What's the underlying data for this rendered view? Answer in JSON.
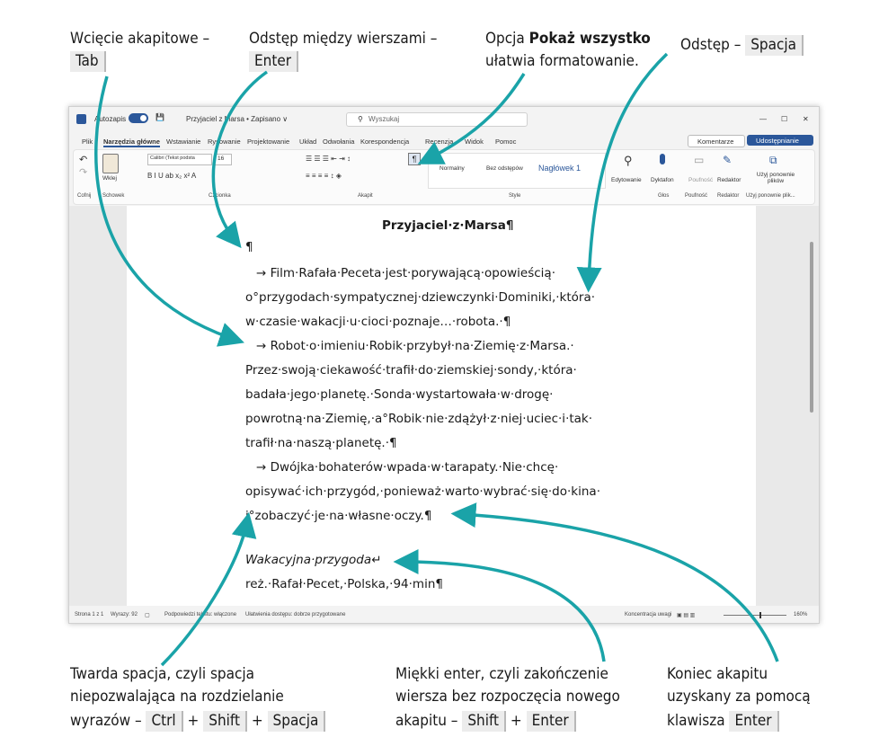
{
  "annotations": {
    "tab": {
      "text": "Wcięcie akapitowe –",
      "key": "Tab"
    },
    "enter": {
      "text": "Odstęp między wierszami –",
      "key": "Enter"
    },
    "show_all": {
      "pre": "Opcja ",
      "bold": "Pokaż wszystko",
      "post": "ułatwia formatowanie."
    },
    "space": {
      "text": "Odstęp –",
      "key": "Spacja"
    },
    "hard_space": {
      "line1": "Twarda spacja, czyli spacja",
      "line2": "niepozwalająca na rozdzielanie",
      "line3": "wyrazów –",
      "key1": "Ctrl",
      "plus1": "+",
      "key2": "Shift",
      "plus2": "+",
      "key3": "Spacja"
    },
    "soft_enter": {
      "line1": "Miękki enter, czyli zakończenie",
      "line2": "wiersza bez rozpoczęcia nowego",
      "line3": "akapitu –",
      "key1": "Shift",
      "plus": "+",
      "key2": "Enter"
    },
    "para_end": {
      "line1": "Koniec akapitu",
      "line2": "uzyskany za pomocą",
      "line3": "klawisza",
      "key": "Enter"
    }
  },
  "window": {
    "autosave": "Autozapis",
    "doc_title": "Przyjaciel z Marsa • Zapisano ∨",
    "search_placeholder": "Wyszukaj",
    "menu": [
      "Plik",
      "Narzędzia główne",
      "Wstawianie",
      "Rysowanie",
      "Projektowanie",
      "Układ",
      "Odwołania",
      "Korespondencja",
      "Recenzja",
      "Widok",
      "Pomoc"
    ],
    "comments": "Komentarze",
    "share": "Udostępnianie",
    "ribbon": {
      "undo_label": "Cofnij",
      "clipboard_label": "Schowek",
      "paste": "Wklej",
      "font_name": "Calibri (Tekst podsta",
      "font_size": "16",
      "font_label": "Czcionka",
      "paragraph_label": "Akapit",
      "style_label": "Style",
      "styles": [
        "Normalny",
        "Bez odstępów",
        "Nagłówek 1"
      ],
      "editing": "Edytowanie",
      "dictate": "Dyktafon",
      "voice_label": "Głos",
      "sensitivity": "Poufność",
      "editor": "Redaktor",
      "reuse": "Użyj ponownie plików",
      "reuse_label": "Użyj ponownie plik..."
    },
    "status": {
      "page": "Strona 1 z 1",
      "words": "Wyrazy: 92",
      "predictions": "Podpowiedzi tekstu: włączone",
      "accessibility": "Ułatwienia dostępu: dobrze przygotowane",
      "focus": "Koncentracja uwagi",
      "zoom": "160%"
    }
  },
  "document": {
    "title": "Przyjaciel·z·Marsa¶",
    "empty_para": "¶",
    "lines": [
      "→  Film·Rafała·Peceta·jest·porywającą·opowieścią·",
      "o°przygodach·sympatycznej·dziewczynki·Dominiki,·która·",
      "w·czasie·wakacji·u·cioci·poznaje…·robota.·¶",
      "→  Robot·o·imieniu·Robik·przybył·na·Ziemię·z·Marsa.·",
      "Przez·swoją·ciekawość·trafił·do·ziemskiej·sondy,·która·",
      "badała·jego·planetę.·Sonda·wystartowała·w·drogę·",
      "powrotną·na·Ziemię,·a°Robik·nie·zdążył·z·niej·uciec·i·tak·",
      "trafił·na·naszą·planetę.·¶",
      "→  Dwójka·bohaterów·wpada·w·tarapaty.·Nie·chcę·",
      "opisywać·ich·przygód,·ponieważ·warto·wybrać·się·do·kina·",
      "i°zobaczyć·je·na·własne·oczy.¶"
    ],
    "italic_line": "Wakacyjna·przygoda↵",
    "last_line": "reż.·Rafał·Pecet,·Polska,·94·min¶"
  },
  "colors": {
    "arrow": "#1aa3a8",
    "accent": "#2b579a",
    "key_bg": "#ececec"
  }
}
